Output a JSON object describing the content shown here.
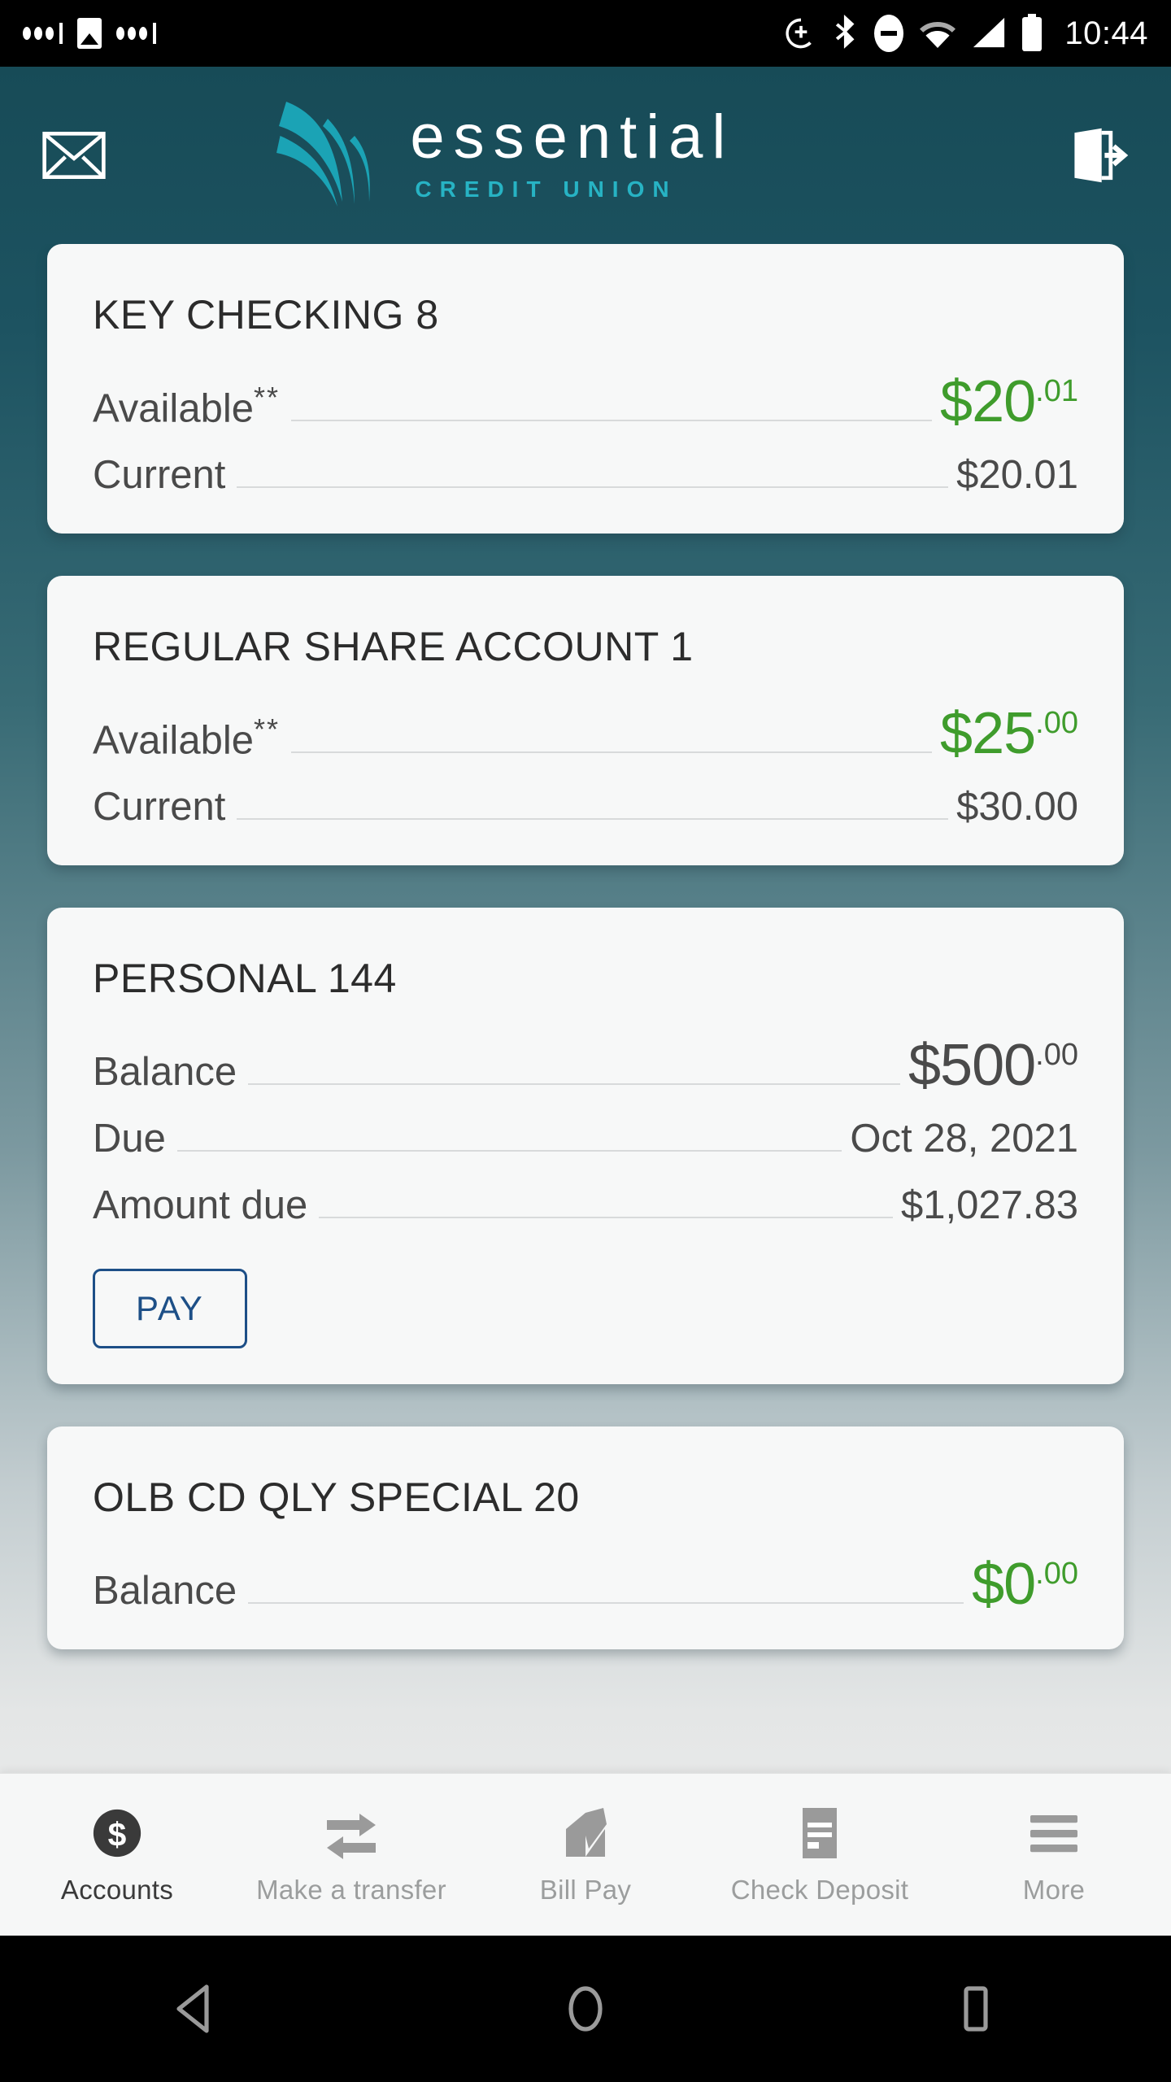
{
  "statusbar": {
    "time": "10:44",
    "icons": [
      "dots-indicator-icon",
      "image-icon",
      "dots-indicator-icon",
      "sync-icon",
      "bluetooth-icon",
      "do-not-disturb-icon",
      "wifi-icon",
      "cell-signal-icon",
      "battery-icon"
    ]
  },
  "header": {
    "mail_icon": "envelope-icon",
    "logout_icon": "logout-icon",
    "brand_name": "essential",
    "brand_sub": "CREDIT UNION",
    "brand_mark": "feather-logo-icon",
    "brand_sub_color": "#27b3c4",
    "bg_top_color": "#174b57"
  },
  "accounts": [
    {
      "title": "KEY CHECKING 8",
      "rows": [
        {
          "label": "Available",
          "sup": "**",
          "value_whole": "$20",
          "value_cents": ".01",
          "big": true,
          "color": "green"
        },
        {
          "label": "Current",
          "sup": "",
          "value": "$20.01",
          "big": false,
          "color": "gray"
        }
      ],
      "action": null
    },
    {
      "title": "REGULAR SHARE ACCOUNT 1",
      "rows": [
        {
          "label": "Available",
          "sup": "**",
          "value_whole": "$25",
          "value_cents": ".00",
          "big": true,
          "color": "green"
        },
        {
          "label": "Current",
          "sup": "",
          "value": "$30.00",
          "big": false,
          "color": "gray"
        }
      ],
      "action": null
    },
    {
      "title": "PERSONAL 144",
      "rows": [
        {
          "label": "Balance",
          "sup": "",
          "value_whole": "$500",
          "value_cents": ".00",
          "big": true,
          "color": "gray"
        },
        {
          "label": "Due",
          "sup": "",
          "value": "Oct 28, 2021",
          "big": false,
          "color": "gray"
        },
        {
          "label": "Amount due",
          "sup": "",
          "value": "$1,027.83",
          "big": false,
          "color": "gray"
        }
      ],
      "action": "PAY"
    },
    {
      "title": "OLB CD QLY SPECIAL 20",
      "rows": [
        {
          "label": "Balance",
          "sup": "",
          "value_whole": "$0",
          "value_cents": ".00",
          "big": true,
          "color": "green"
        }
      ],
      "action": null
    }
  ],
  "bottom_nav": {
    "items": [
      {
        "label": "Accounts",
        "icon": "dollar-circle-icon",
        "active": true
      },
      {
        "label": "Make a transfer",
        "icon": "transfer-arrows-icon",
        "active": false
      },
      {
        "label": "Bill Pay",
        "icon": "envelope-pen-icon",
        "active": false
      },
      {
        "label": "Check Deposit",
        "icon": "check-card-icon",
        "active": false
      },
      {
        "label": "More",
        "icon": "hamburger-menu-icon",
        "active": false
      }
    ]
  },
  "android_nav": {
    "back": "back-triangle-icon",
    "home": "home-circle-icon",
    "recents": "recents-square-icon"
  },
  "colors": {
    "green_amount": "#3f9c2c",
    "pay_blue": "#1d4f87",
    "brand_teal": "#1ba3b5",
    "card_bg": "#f7f8f8"
  }
}
